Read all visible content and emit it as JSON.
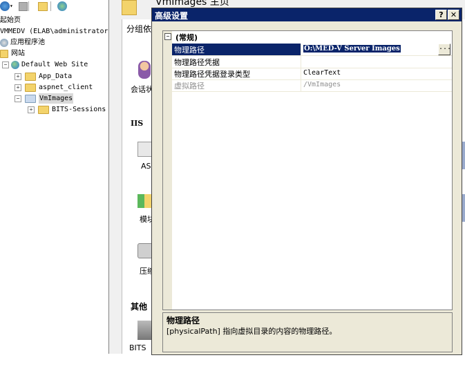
{
  "tree": {
    "items": [
      {
        "label": "起始页"
      },
      {
        "label": "VMMEDV (ELAB\\administrator"
      },
      {
        "label": "应用程序池"
      },
      {
        "label": "网站"
      },
      {
        "label": "Default Web Site"
      },
      {
        "label": "App_Data"
      },
      {
        "label": "aspnet_client"
      },
      {
        "label": "VmImages"
      },
      {
        "label": "BITS-Sessions"
      }
    ]
  },
  "background": {
    "title": "VmImages 主页",
    "group_by_label": "分组依",
    "features": {
      "session": "会话状",
      "iis_header": "IIS",
      "asp": "ASI",
      "modules": "模块",
      "compression": "压缩",
      "other_header": "其他",
      "bits": "BITS"
    }
  },
  "dialog": {
    "title": "高级设置",
    "help_btn": "?",
    "close_btn": "✕",
    "category": "(常规)",
    "rows": [
      {
        "name": "物理路径",
        "value": "O:\\MED-V Server Images",
        "selected": true
      },
      {
        "name": "物理路径凭据",
        "value": ""
      },
      {
        "name": "物理路径凭据登录类型",
        "value": "ClearText"
      },
      {
        "name": "虚拟路径",
        "value": "/VmImages",
        "disabled": true
      }
    ],
    "browse_btn": "...",
    "description": {
      "title": "物理路径",
      "text": "[physicalPath] 指向虚拟目录的内容的物理路径。"
    }
  },
  "colors": {
    "titlebar": "#0a246a",
    "selection": "#0a246a",
    "dialog_bg": "#ece9d8"
  }
}
